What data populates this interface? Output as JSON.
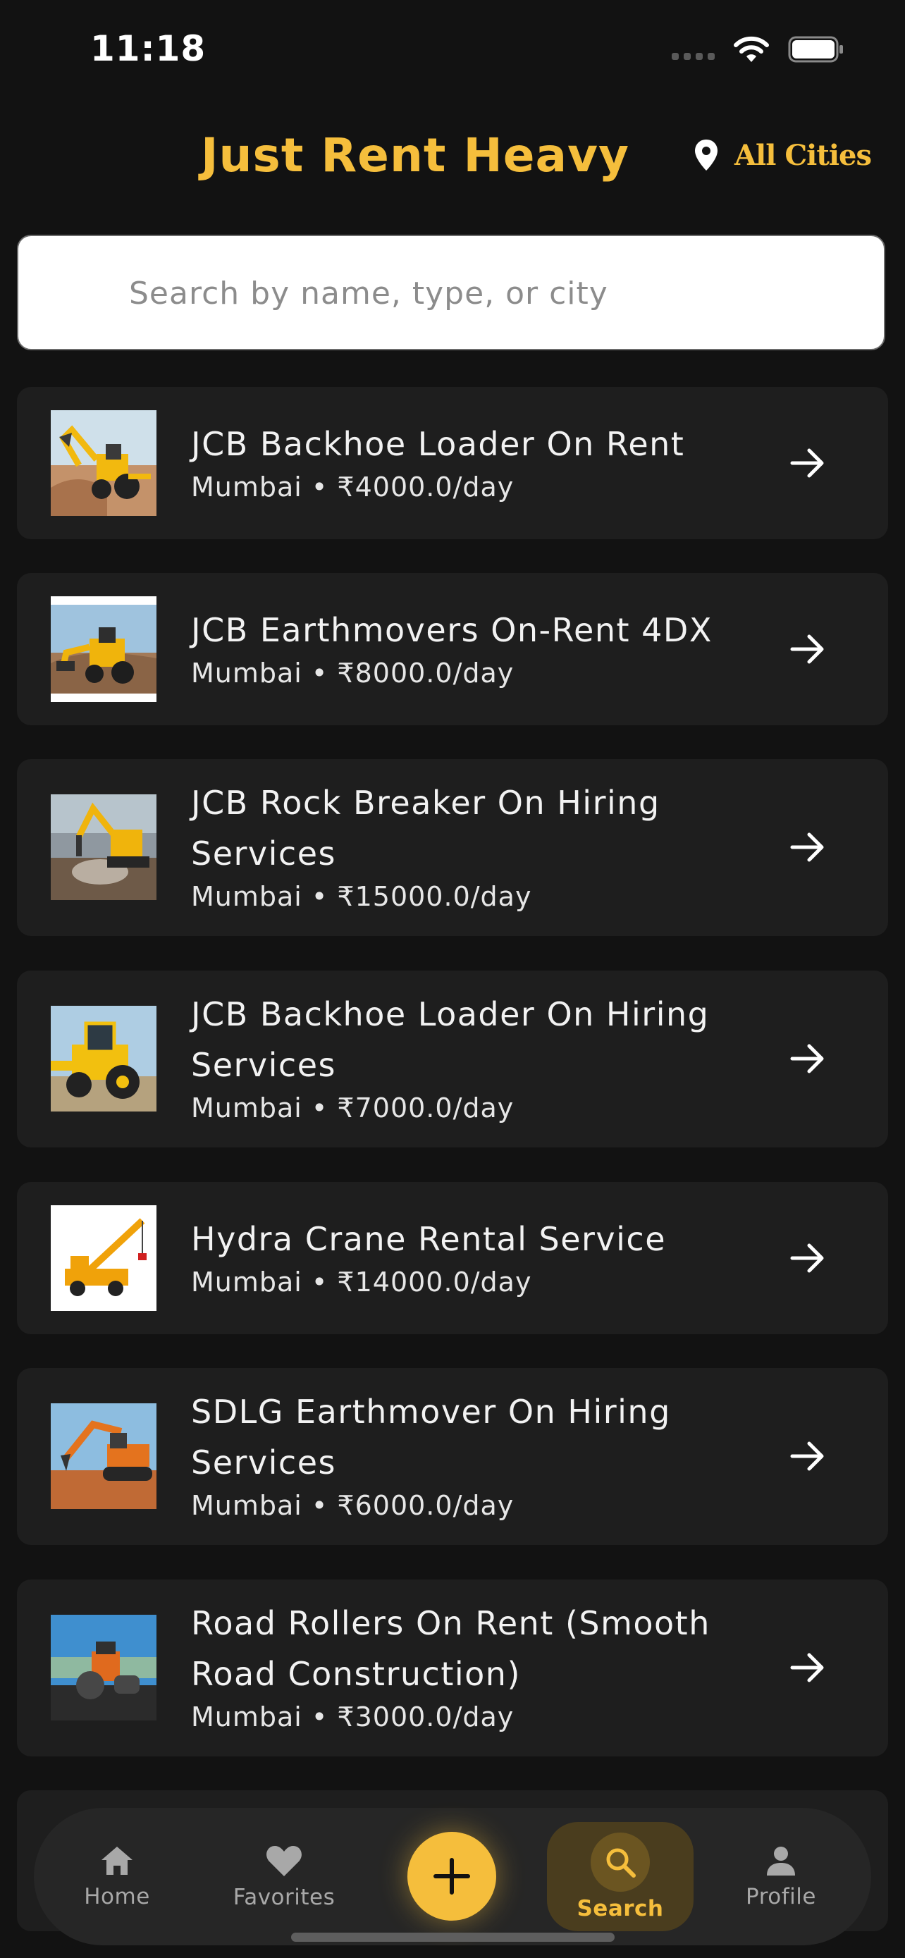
{
  "status": {
    "time": "11:18"
  },
  "header": {
    "title": "Just Rent Heavy",
    "city_label": "All Cities"
  },
  "search": {
    "placeholder": "Search by name, type, or city",
    "value": ""
  },
  "listings": [
    {
      "title": "JCB Backhoe Loader On Rent",
      "subtitle": "Mumbai • ₹4000.0/day"
    },
    {
      "title": "JCB Earthmovers On-Rent 4DX",
      "subtitle": "Mumbai • ₹8000.0/day"
    },
    {
      "title": "JCB Rock Breaker On Hiring Services",
      "subtitle": "Mumbai • ₹15000.0/day"
    },
    {
      "title": "JCB Backhoe Loader On Hiring Services",
      "subtitle": "Mumbai • ₹7000.0/day"
    },
    {
      "title": "Hydra Crane Rental Service",
      "subtitle": "Mumbai • ₹14000.0/day"
    },
    {
      "title": "SDLG Earthmover On Hiring Services",
      "subtitle": "Mumbai • ₹6000.0/day"
    },
    {
      "title": "Road Rollers On Rent (Smooth Road Construction)",
      "subtitle": "Mumbai • ₹3000.0/day"
    }
  ],
  "nav": {
    "home": "Home",
    "favorites": "Favorites",
    "search": "Search",
    "profile": "Profile",
    "active": "search"
  },
  "colors": {
    "accent": "#F5BE3C",
    "background": "#121212",
    "card": "#1E1E1E"
  }
}
